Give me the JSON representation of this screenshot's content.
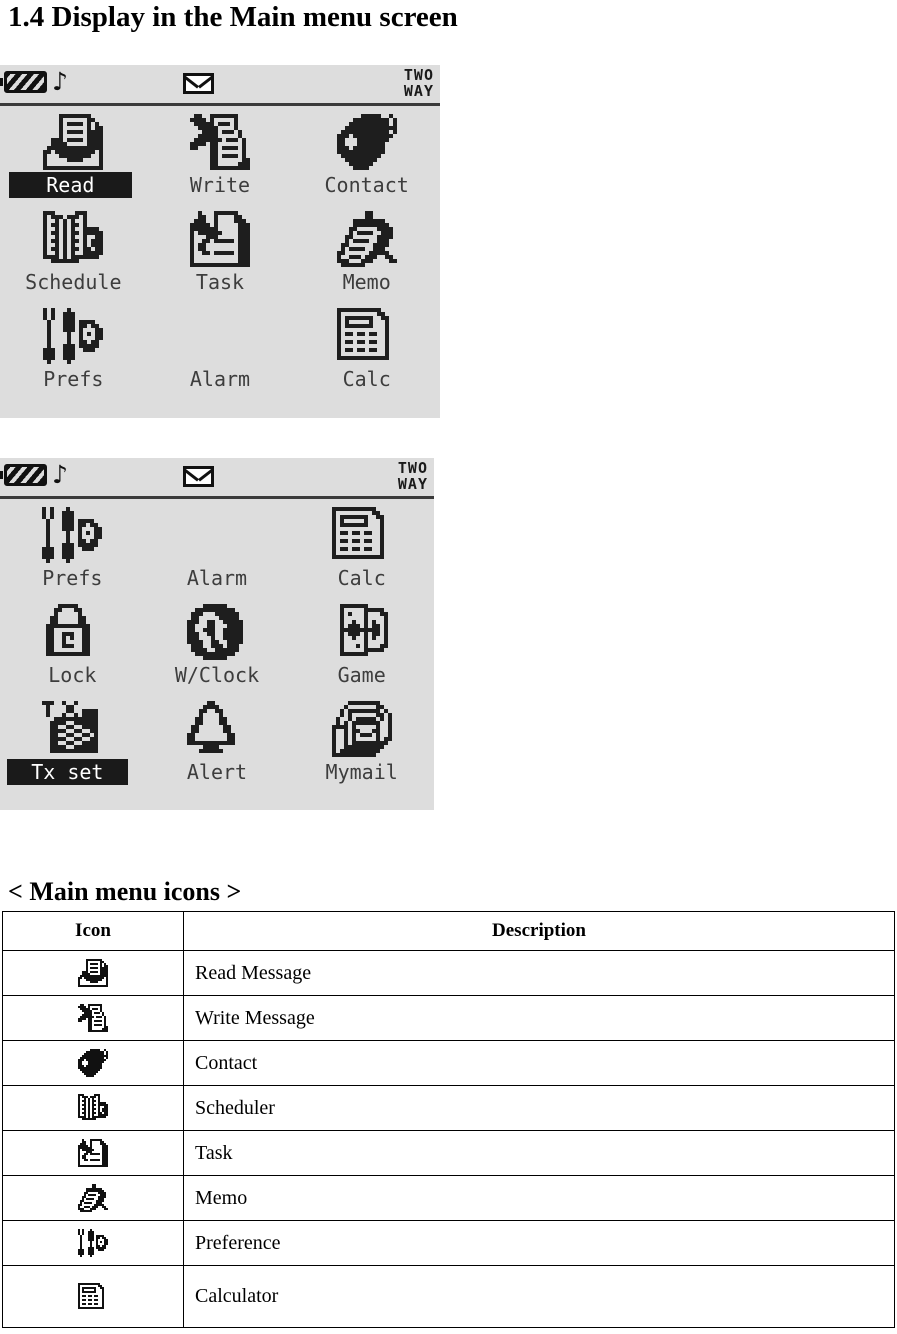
{
  "heading": "1.4 Display in the Main menu screen",
  "section_caption": "< Main menu icons >",
  "status_bar": {
    "battery_icon": "battery-icon",
    "sound_icon": "music-note-icon",
    "mail_icon": "envelope-icon",
    "network_label_line1": "TWO",
    "network_label_line2": "WAY"
  },
  "screens": [
    {
      "name": "main-menu-page-1",
      "items": [
        {
          "label": "Read",
          "icon": "read-message-icon",
          "selected": true
        },
        {
          "label": "Write",
          "icon": "write-message-icon",
          "selected": false
        },
        {
          "label": "Contact",
          "icon": "contact-icon",
          "selected": false
        },
        {
          "label": "Schedule",
          "icon": "scheduler-icon",
          "selected": false
        },
        {
          "label": "Task",
          "icon": "task-icon",
          "selected": false
        },
        {
          "label": "Memo",
          "icon": "memo-icon",
          "selected": false
        },
        {
          "label": "Prefs",
          "icon": "preference-icon",
          "selected": false
        },
        {
          "label": "Alarm",
          "icon": "alarm-clock-icon",
          "selected": false
        },
        {
          "label": "Calc",
          "icon": "calculator-icon",
          "selected": false
        }
      ]
    },
    {
      "name": "main-menu-page-2",
      "items": [
        {
          "label": "Prefs",
          "icon": "preference-icon",
          "selected": false
        },
        {
          "label": "Alarm",
          "icon": "alarm-clock-icon",
          "selected": false
        },
        {
          "label": "Calc",
          "icon": "calculator-icon",
          "selected": false
        },
        {
          "label": "Lock",
          "icon": "padlock-icon",
          "selected": false
        },
        {
          "label": "W/Clock",
          "icon": "world-clock-globe-icon",
          "selected": false
        },
        {
          "label": "Game",
          "icon": "playing-cards-icon",
          "selected": false
        },
        {
          "label": "Tx set",
          "icon": "tx-setting-envelope-icon",
          "selected": true
        },
        {
          "label": "Alert",
          "icon": "bell-icon",
          "selected": false
        },
        {
          "label": "Mymail",
          "icon": "mymail-envelopes-icon",
          "selected": false
        }
      ]
    }
  ],
  "table": {
    "headers": {
      "icon": "Icon",
      "description": "Description"
    },
    "rows": [
      {
        "icon": "read-message-icon",
        "description": "Read Message"
      },
      {
        "icon": "write-message-icon",
        "description": "Write Message"
      },
      {
        "icon": "contact-icon",
        "description": "Contact"
      },
      {
        "icon": "scheduler-icon",
        "description": "Scheduler"
      },
      {
        "icon": "task-icon",
        "description": "Task"
      },
      {
        "icon": "memo-icon",
        "description": "Memo"
      },
      {
        "icon": "preference-icon",
        "description": "Preference"
      },
      {
        "icon": "calculator-icon",
        "description": "Calculator"
      }
    ]
  },
  "colors": {
    "lcd_background": "#dddddd",
    "lcd_ink": "#3d3d3d",
    "highlight_background": "#1a1a1a",
    "highlight_text": "#ffffff",
    "page_background": "#ffffff"
  }
}
